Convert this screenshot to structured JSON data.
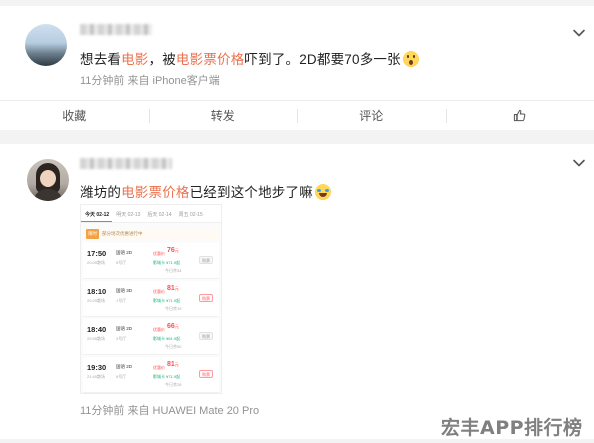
{
  "post1": {
    "text_pre": "想去看",
    "text_hl1": "电影",
    "text_mid": "，被",
    "text_hl2": "电影票价格",
    "text_post": "吓到了。2D都要70多一张",
    "meta": "11分钟前  来自 iPhone客户端",
    "actions": {
      "favorite": "收藏",
      "repost": "转发",
      "comment": "评论"
    }
  },
  "post2": {
    "text_pre": "潍坊的",
    "text_hl": "电影票价格",
    "text_post": "已经到这个地步了嘛",
    "meta": "11分钟前  来自 HUAWEI Mate 20 Pro",
    "screenshot": {
      "tabs": [
        "今天 02-12",
        "明天 02-13",
        "后天 02-14",
        "周五 02-15"
      ],
      "banner_tag": "限时",
      "banner_text": "部分场次优惠进行中",
      "shows": [
        {
          "time": "17:50",
          "end": "20:05散场",
          "lang": "国语 2D",
          "hall": "5号厅",
          "price_label": "优惠价",
          "price": "76",
          "unit": "元",
          "vip": "影城卡 ¥71.9起",
          "member": "今日余34",
          "button": "购票",
          "soft": true
        },
        {
          "time": "18:10",
          "end": "20:25散场",
          "lang": "国语 3D",
          "hall": "1号厅",
          "price_label": "优惠价",
          "price": "81",
          "unit": "元",
          "vip": "影城卡 ¥71.9起",
          "member": "今日余19",
          "button": "购票",
          "soft": false
        },
        {
          "time": "18:40",
          "end": "20:55散场",
          "lang": "国语 2D",
          "hall": "3号厅",
          "price_label": "优惠价",
          "price": "66",
          "unit": "元",
          "vip": "影城卡 ¥61.9起",
          "member": "今日余50",
          "button": "购票",
          "soft": true
        },
        {
          "time": "19:30",
          "end": "21:45散场",
          "lang": "国语 2D",
          "hall": "6号厅",
          "price_label": "优惠价",
          "price": "81",
          "unit": "元",
          "vip": "影城卡 ¥71.9起",
          "member": "今日余28",
          "button": "购票",
          "soft": false
        }
      ]
    }
  },
  "watermark": "宏丰APP排行榜",
  "colors": {
    "highlight": "#eb7350",
    "price": "#ff4d4f",
    "vip": "#19b37a"
  },
  "icons": {
    "menu": "chevron-down-icon",
    "like": "thumbs-up-icon"
  }
}
